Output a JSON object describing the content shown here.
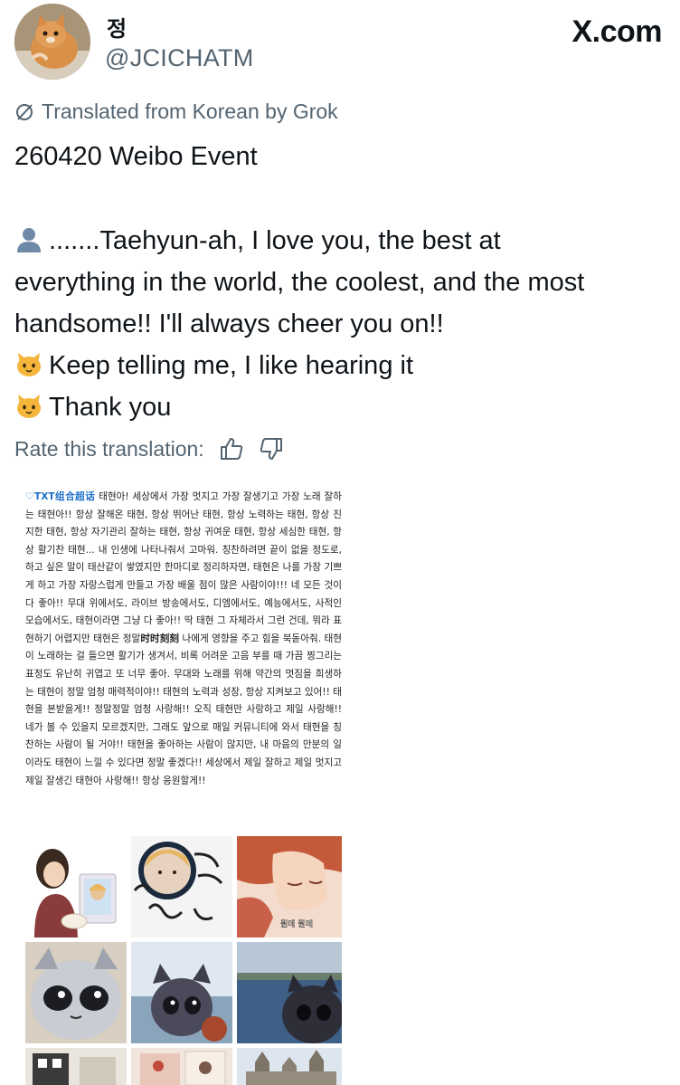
{
  "author": {
    "display_name": "정",
    "handle": "@JCICHATM"
  },
  "site_logo": "X.com",
  "translation_notice": "Translated from Korean by Grok",
  "tweet": {
    "line1": "260420 Weibo Event",
    "line2": ".......Taehyun-ah, I love you, the best at",
    "line3": "everything in the world, the coolest, and the most",
    "line4": "handsome!! I'll always cheer you on!!",
    "line5": "Keep telling me, I like hearing it",
    "line6": "Thank you"
  },
  "rate": {
    "label": "Rate this translation:"
  },
  "icons": {
    "translate": "slashed-circle-icon",
    "speaker": "bust-silhouette-emoji",
    "cat": "cat-face-emoji",
    "like": "thumbs-up-icon",
    "dislike": "thumbs-down-icon"
  },
  "weibo_post": {
    "tag": "♡TXT组合超话",
    "body_part1": " 태현아! 세상에서 가장 멋지고 가장 잘생기고 가장 노래 잘하는 태현아!! 항상 잘해온 태현, 항상 뛰어난 태현, 항상 노력하는 태현, 항상 진지한 태현, 항상 자기관리 잘하는 태현, 항상 귀여운 태현, 항상 세심한 태현, 항상 활기찬 태현... 내 인생에 나타나줘서 고마워. 칭찬하려면 끝이 없을 정도로, 하고 싶은 말이 태산같이 쌓였지만 한마디로 정리하자면, 태현은 나를 가장 기쁘게 하고 가장 자랑스럽게 만들고 가장 배울 점이 많은 사람이야!!! 네 모든 것이 다 좋아!! 무대 위에서도, 라이브 방송에서도, 디엠에서도, 예능에서도, 사적인 모습에서도, 태현이라면 그냥 다 좋아!! 딱 태현 그 자체라서 그런 건데, 뭐라 표현하기 어렵지만 태현은 정말",
    "highlight": "时时刻刻",
    "body_part2": " 나에게 영향을 주고 힘을 북돋아줘. 태현이 노래하는 걸 들으면 활기가 생겨서, 비록 어려운 고음 부를 때 가끔 찡그리는 표정도 유난히 귀엽고 또 너무 좋아. 무대와 노래를 위해 약간의 멋짐을 희생하는 태현이 정말 엄청 매력적이야!! 태현의 노력과 성장, 항상 지켜보고 있어!! 태현을 본받을게!! 정말정말 엄청 사랑해!! 오직 태현만 사랑하고 제일 사랑해!! 네가 볼 수 있을지 모르겠지만, 그래도 앞으로 매일 커뮤니티에 와서 태현을 칭찬하는 사람이 될 거야!! 태현을 좋아하는 사람이 많지만, 내 마음의 만분의 일이라도 태현이 느낄 수 있다면 정말 좋겠다!! 세상에서 제일 잘하고 제일 멋지고 제일 잘생긴 태현아 사랑해!! 항상 응원할게!!"
  },
  "photos": {
    "p3_caption": "뭔데 뭔데"
  },
  "colors": {
    "text": "#0f1419",
    "muted": "#536471",
    "weibo_tag": "#1a6dc8"
  }
}
